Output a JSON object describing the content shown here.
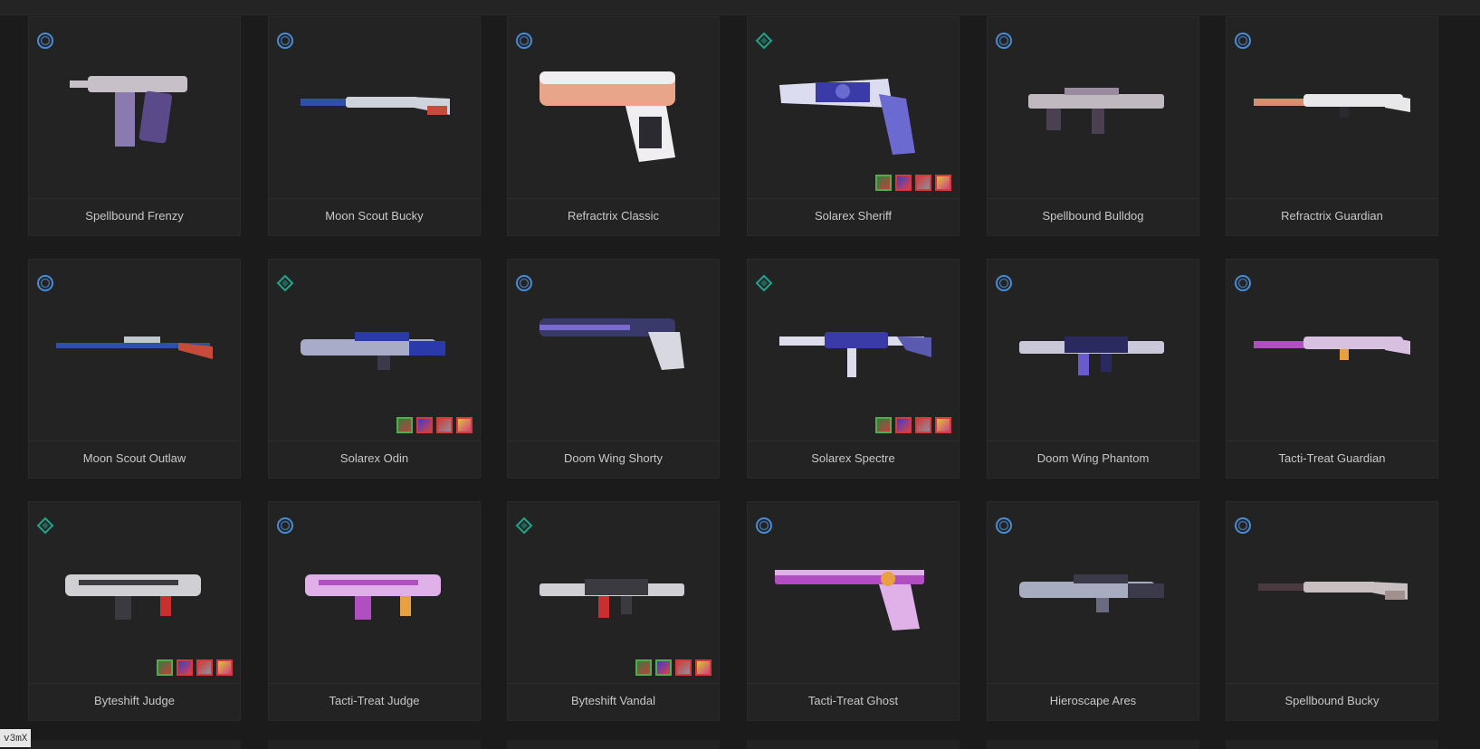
{
  "corner_tag": "v3mX",
  "colors": {
    "bg": "#1b1b1c",
    "card": "#232324",
    "deluxe_tier": "#4a8cd4",
    "premium_tier": "#1fa58a"
  },
  "skins": [
    {
      "name": "Spellbound Frenzy",
      "tier": "deluxe",
      "tier_icon": "deluxe-tier-icon",
      "weapon": "pistol-smg",
      "palette": [
        "#c8c0c8",
        "#5a4a8a",
        "#8a7ab0"
      ],
      "chromas": []
    },
    {
      "name": "Moon Scout Bucky",
      "tier": "deluxe",
      "tier_icon": "deluxe-tier-icon",
      "weapon": "shotgun",
      "palette": [
        "#cfd4dc",
        "#2f4fa8",
        "#c84a3a"
      ],
      "chromas": []
    },
    {
      "name": "Refractrix Classic",
      "tier": "deluxe",
      "tier_icon": "deluxe-tier-icon",
      "weapon": "pistol",
      "palette": [
        "#f0eef0",
        "#e8a58a",
        "#2a2a30"
      ],
      "chromas": []
    },
    {
      "name": "Solarex Sheriff",
      "tier": "premium",
      "tier_icon": "premium-tier-icon",
      "weapon": "revolver",
      "palette": [
        "#dcdcf0",
        "#3a3aa8",
        "#6a6ad0"
      ],
      "chromas": [
        "green",
        "red",
        "red",
        "red"
      ]
    },
    {
      "name": "Spellbound Bulldog",
      "tier": "deluxe",
      "tier_icon": "deluxe-tier-icon",
      "weapon": "rifle-bullpup",
      "palette": [
        "#c0bac0",
        "#4a4050",
        "#9a8aa0"
      ],
      "chromas": []
    },
    {
      "name": "Refractrix Guardian",
      "tier": "deluxe",
      "tier_icon": "deluxe-tier-icon",
      "weapon": "rifle-long",
      "palette": [
        "#e8e8ea",
        "#d49070",
        "#2a2a30"
      ],
      "chromas": []
    },
    {
      "name": "Moon Scout Outlaw",
      "tier": "deluxe",
      "tier_icon": "deluxe-tier-icon",
      "weapon": "sniper",
      "palette": [
        "#c0c8d0",
        "#2f4fa8",
        "#c84a3a"
      ],
      "chromas": []
    },
    {
      "name": "Solarex Odin",
      "tier": "premium",
      "tier_icon": "premium-tier-icon",
      "weapon": "lmg",
      "palette": [
        "#a8acc8",
        "#2a3aa8",
        "#3a3a4a"
      ],
      "chromas": [
        "green",
        "red",
        "red",
        "red"
      ]
    },
    {
      "name": "Doom Wing Shorty",
      "tier": "deluxe",
      "tier_icon": "deluxe-tier-icon",
      "weapon": "shorty",
      "palette": [
        "#d8d8e0",
        "#3a3a6a",
        "#7a6ad0"
      ],
      "chromas": []
    },
    {
      "name": "Solarex Spectre",
      "tier": "premium",
      "tier_icon": "premium-tier-icon",
      "weapon": "smg",
      "palette": [
        "#dcdcec",
        "#3a3aa8",
        "#5a5ab0"
      ],
      "chromas": [
        "green",
        "red",
        "red",
        "red"
      ]
    },
    {
      "name": "Doom Wing Phantom",
      "tier": "deluxe",
      "tier_icon": "deluxe-tier-icon",
      "weapon": "rifle",
      "palette": [
        "#c8c8d8",
        "#2a2a60",
        "#6a5ad0"
      ],
      "chromas": []
    },
    {
      "name": "Tacti-Treat Guardian",
      "tier": "deluxe",
      "tier_icon": "deluxe-tier-icon",
      "weapon": "rifle-long",
      "palette": [
        "#d8c0e0",
        "#b050c0",
        "#e8a040"
      ],
      "chromas": []
    },
    {
      "name": "Byteshift Judge",
      "tier": "premium",
      "tier_icon": "premium-tier-icon",
      "weapon": "shotgun-auto",
      "palette": [
        "#d0d0d4",
        "#3a3a40",
        "#c83030"
      ],
      "chromas": [
        "green",
        "red",
        "red",
        "red"
      ]
    },
    {
      "name": "Tacti-Treat Judge",
      "tier": "deluxe",
      "tier_icon": "deluxe-tier-icon",
      "weapon": "shotgun-auto",
      "palette": [
        "#e0b0e8",
        "#b050c0",
        "#e8a040"
      ],
      "chromas": []
    },
    {
      "name": "Byteshift Vandal",
      "tier": "premium",
      "tier_icon": "premium-tier-icon",
      "weapon": "rifle",
      "palette": [
        "#d0d0d4",
        "#3a3a40",
        "#c83030"
      ],
      "chromas": [
        "green",
        "green",
        "red",
        "red"
      ]
    },
    {
      "name": "Tacti-Treat Ghost",
      "tier": "deluxe",
      "tier_icon": "deluxe-tier-icon",
      "weapon": "pistol-long",
      "palette": [
        "#e0b0e8",
        "#b050c0",
        "#e8a040"
      ],
      "chromas": []
    },
    {
      "name": "Hieroscape Ares",
      "tier": "deluxe",
      "tier_icon": "deluxe-tier-icon",
      "weapon": "lmg",
      "palette": [
        "#a8acc0",
        "#3a3a4a",
        "#6a6a80"
      ],
      "chromas": []
    },
    {
      "name": "Spellbound Bucky",
      "tier": "deluxe",
      "tier_icon": "deluxe-tier-icon",
      "weapon": "shotgun",
      "palette": [
        "#c8c0c0",
        "#4a3a40",
        "#a09090"
      ],
      "chromas": []
    }
  ]
}
